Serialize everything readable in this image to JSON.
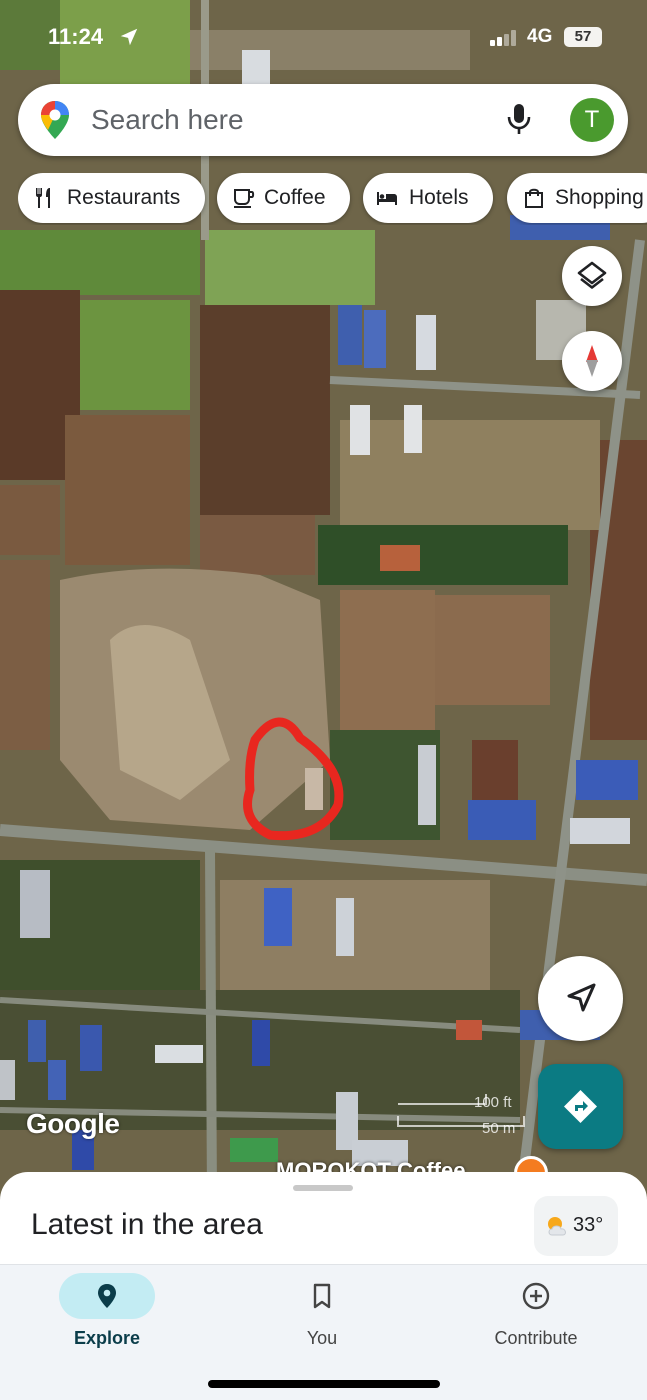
{
  "status_bar": {
    "time": "11:24",
    "network": "4G",
    "battery": "57",
    "location_icon": "location-arrow-icon"
  },
  "search": {
    "placeholder": "Search here",
    "mic_icon": "mic-icon",
    "avatar_letter": "T",
    "avatar_color": "#4a9a2e"
  },
  "chips": [
    {
      "label": "Restaurants",
      "icon": "fork-knife-icon"
    },
    {
      "label": "Coffee",
      "icon": "coffee-cup-icon"
    },
    {
      "label": "Hotels",
      "icon": "bed-icon"
    },
    {
      "label": "Shopping",
      "icon": "shopping-bag-icon"
    }
  ],
  "map": {
    "attribution": "Google",
    "scale_ft": "100 ft",
    "scale_m": "50 m",
    "poi_label": "MOROKOT Coffee",
    "highlight_color": "#e8271f"
  },
  "sheet": {
    "title": "Latest in the area",
    "temperature": "33°"
  },
  "nav": {
    "items": [
      {
        "label": "Explore",
        "icon": "explore-pin-icon",
        "active": true
      },
      {
        "label": "You",
        "icon": "bookmark-icon",
        "active": false
      },
      {
        "label": "Contribute",
        "icon": "add-circle-icon",
        "active": false
      }
    ]
  },
  "colors": {
    "accent": "#0b7b83",
    "nav_active_pill": "#c3ecf3"
  }
}
